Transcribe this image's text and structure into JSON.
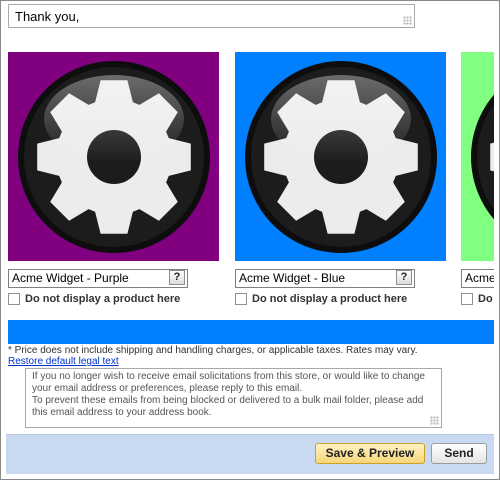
{
  "message": {
    "value": "Thank you,"
  },
  "products": [
    {
      "name": "Acme Widget - Purple",
      "help_label": "?",
      "checkbox_label": "Do not display a product here",
      "bg_color": "#800080",
      "icon": "gear-icon"
    },
    {
      "name": "Acme Widget - Blue",
      "help_label": "?",
      "checkbox_label": "Do not display a product here",
      "bg_color": "#0080ff",
      "icon": "gear-icon"
    },
    {
      "name": "Acme Widget - Green",
      "help_label": "?",
      "checkbox_label": "Do not display a product here",
      "bg_color": "#80ff80",
      "icon": "gear-icon"
    }
  ],
  "accent_bar_color": "#0080ff",
  "disclaimer": "* Price does not include shipping and handling charges, or applicable taxes. Rates may vary.",
  "restore_link": "Restore default legal text",
  "legal_text": [
    "If you no longer wish to receive email solicitations from this store, or would like to change your email address or preferences, please reply to this email.",
    "To prevent these emails from being blocked or delivered to a bulk mail folder, please add this email address to your address book."
  ],
  "footer": {
    "save_preview_label": "Save & Preview",
    "send_label": "Send",
    "bg_color": "#c9d9f2"
  }
}
